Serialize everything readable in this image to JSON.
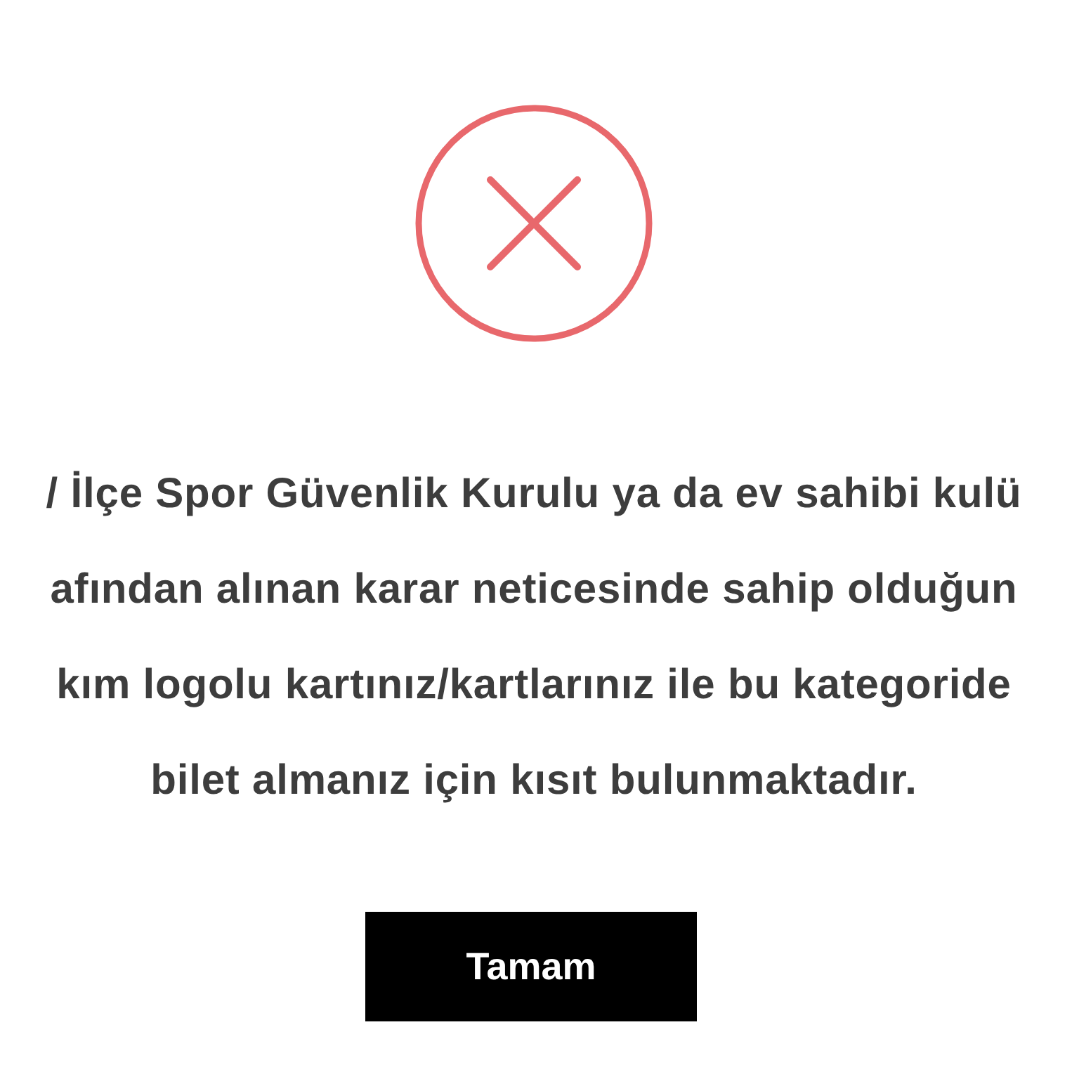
{
  "dialog": {
    "icon": {
      "kind": "error"
    },
    "message_lines": [
      "/ İlçe Spor Güvenlik Kurulu ya da ev sahibi kulü",
      "afından alınan karar neticesinde sahip olduğun",
      "kım logolu kartınız/kartlarınız ile bu kategoride",
      "bilet almanız için kısıt bulunmaktadır."
    ],
    "button": "Tamam"
  }
}
